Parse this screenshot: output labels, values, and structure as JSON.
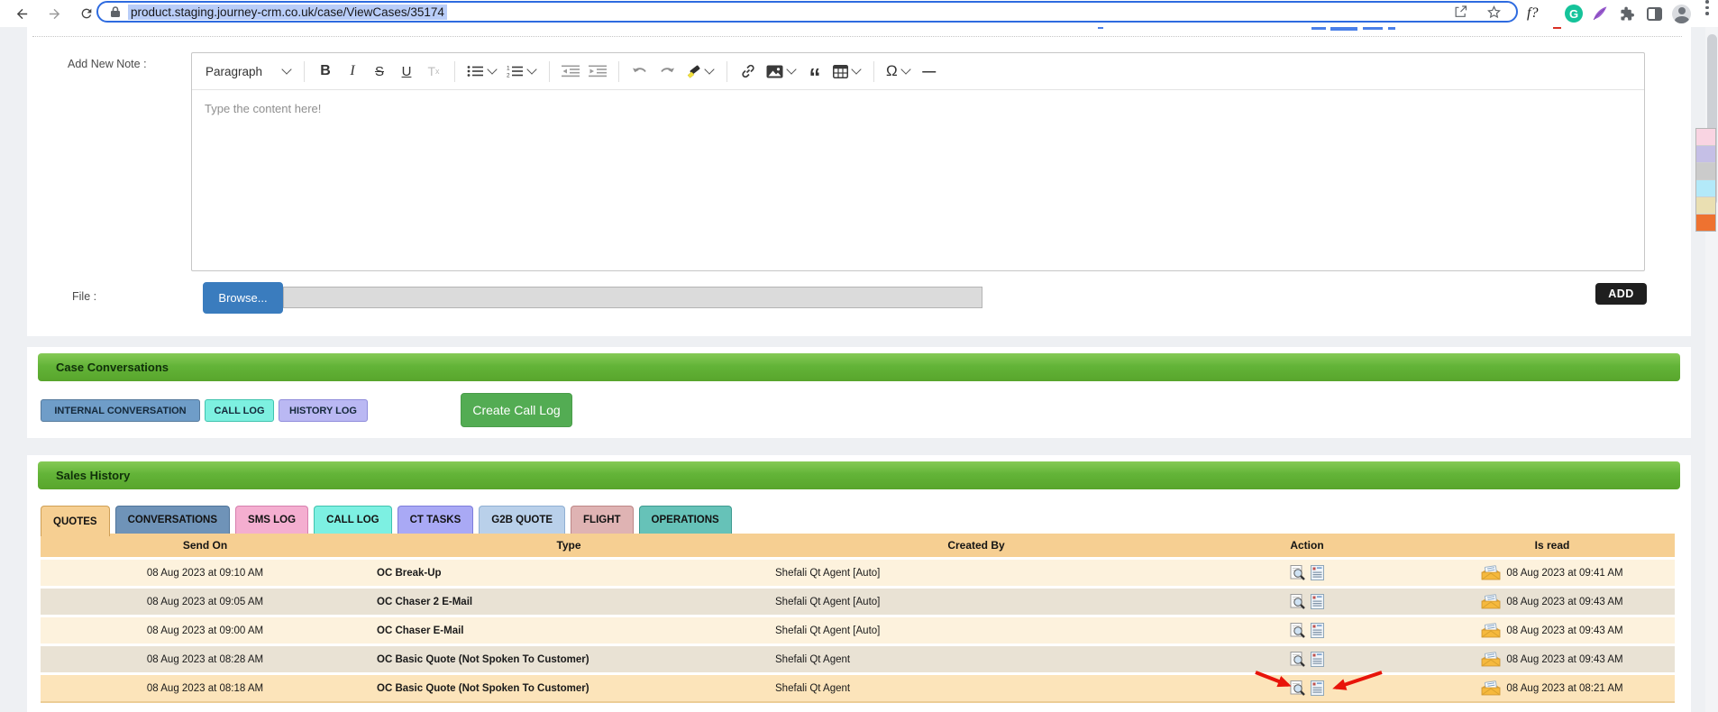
{
  "browser": {
    "url": "product.staging.journey-crm.co.uk/case/ViewCases/35174",
    "fn_ext_label": "f?",
    "grammarly_letter": "G"
  },
  "note_form": {
    "add_note_label": "Add New Note :",
    "file_label": "File :",
    "browse_button": "Browse...",
    "add_button": "ADD",
    "editor": {
      "paragraph_dropdown": "Paragraph",
      "placeholder": "Type the content here!",
      "bold": "B",
      "italic": "I",
      "strike": "S",
      "underline": "U",
      "remove_format_t": "T",
      "remove_format_x": "x",
      "quote_mark": "“",
      "special_char": "Ω",
      "horizontal_rule": "—"
    }
  },
  "case_conversations": {
    "title": "Case Conversations",
    "buttons": [
      {
        "label": "INTERNAL CONVERSATION",
        "bg": "#6f9dc8",
        "border": "#54799c"
      },
      {
        "label": "CALL LOG",
        "bg": "#7df0e0",
        "border": "#3fc3ae"
      },
      {
        "label": "HISTORY LOG",
        "bg": "#bab8f3",
        "border": "#8f8cdb"
      }
    ],
    "create_call_log": "Create Call Log"
  },
  "sales_history": {
    "title": "Sales History",
    "tabs": [
      {
        "label": "QUOTES",
        "bg": "#f6cf92",
        "border": "#cf9f55"
      },
      {
        "label": "CONVERSATIONS",
        "bg": "#6f93b8",
        "border": "#4f749a"
      },
      {
        "label": "SMS LOG",
        "bg": "#f4aed0",
        "border": "#d77fae"
      },
      {
        "label": "CALL LOG",
        "bg": "#7df0e2",
        "border": "#3fc3ae"
      },
      {
        "label": "CT TASKS",
        "bg": "#a9a9f5",
        "border": "#7d7ddb"
      },
      {
        "label": "G2B QUOTE",
        "bg": "#b9d0ea",
        "border": "#8fafd2"
      },
      {
        "label": "FLIGHT",
        "bg": "#dfb3b3",
        "border": "#bd8787"
      },
      {
        "label": "OPERATIONS",
        "bg": "#66c2b8",
        "border": "#3e9a90"
      }
    ],
    "table": {
      "columns": [
        "Send On",
        "Type",
        "Created By",
        "Action",
        "Is read"
      ],
      "rows": [
        {
          "send_on": "08 Aug 2023 at 09:10 AM",
          "type": "OC Break-Up",
          "created_by": "Shefali Qt Agent [Auto]",
          "is_read": "08 Aug 2023 at 09:41 AM"
        },
        {
          "send_on": "08 Aug 2023 at 09:05 AM",
          "type": "OC Chaser 2 E-Mail",
          "created_by": "Shefali Qt Agent [Auto]",
          "is_read": "08 Aug 2023 at 09:43 AM"
        },
        {
          "send_on": "08 Aug 2023 at 09:00 AM",
          "type": "OC Chaser E-Mail",
          "created_by": "Shefali Qt Agent [Auto]",
          "is_read": "08 Aug 2023 at 09:43 AM"
        },
        {
          "send_on": "08 Aug 2023 at 08:28 AM",
          "type": "OC Basic Quote (Not Spoken To Customer)",
          "created_by": "Shefali Qt Agent",
          "is_read": "08 Aug 2023 at 09:43 AM"
        },
        {
          "send_on": "08 Aug 2023 at 08:18 AM",
          "type": "OC Basic Quote (Not Spoken To Customer)",
          "created_by": "Shefali Qt Agent",
          "is_read": "08 Aug 2023 at 08:21 AM"
        }
      ]
    }
  },
  "palette": {
    "swatches": [
      "#f9d4e2",
      "#c5bfe6",
      "#cbcbcb",
      "#b3e9f9",
      "#eadfb2",
      "#ee7230"
    ]
  },
  "colors": {
    "section_green": "#5aa52c",
    "table_header": "#f6cf92",
    "row_light": "#fdf2dd",
    "row_dark": "#e9e2d4",
    "row_highlight": "#fce4ba",
    "arrow_red": "#e8150a",
    "browse_blue": "#3a7cbe",
    "url_selection": "#b9cdf8"
  }
}
